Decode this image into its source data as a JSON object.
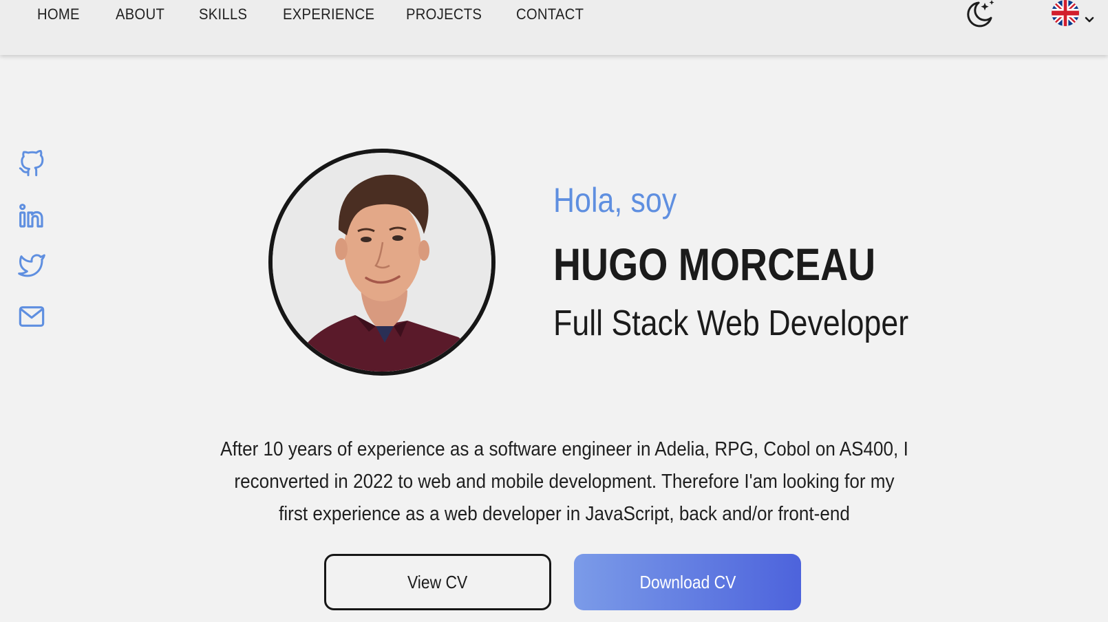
{
  "nav": {
    "links": [
      "HOME",
      "ABOUT",
      "SKILLS",
      "EXPERIENCE",
      "PROJECTS",
      "CONTACT"
    ],
    "theme_icon": "moon-stars-icon",
    "language_icon": "uk-flag-icon"
  },
  "social": {
    "items": [
      "github-icon",
      "linkedin-icon",
      "twitter-icon",
      "mail-icon"
    ],
    "color": "#5f8fe0"
  },
  "hero": {
    "greeting": "Hola, soy",
    "name": "HUGO MORCEAU",
    "role": "Full Stack Web Developer",
    "bio_lines": [
      "After 10 years of experience as a software engineer in Adelia, RPG, Cobol on AS400, I",
      "reconverted in 2022 to web and mobile development. Therefore I'am looking for my",
      "first experience as a web developer in JavaScript, back and/or front-end"
    ]
  },
  "buttons": {
    "view_cv": "View CV",
    "download_cv": "Download CV"
  },
  "colors": {
    "accent": "#5f8fe0",
    "background": "#f2f2f2",
    "navbar": "#ededed",
    "gradient_start": "#7b9be8",
    "gradient_end": "#4d63dc"
  }
}
